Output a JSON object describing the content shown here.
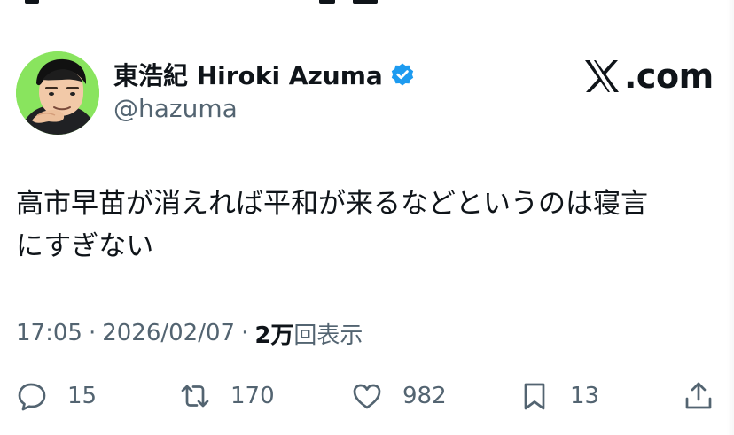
{
  "author": {
    "display_name": "東浩紀 Hiroki Azuma",
    "username": "@hazuma",
    "verified": true
  },
  "site": {
    "mark_icon": "x-logo-icon",
    "suffix": ".com"
  },
  "tweet": {
    "text": "高市早苗が消えれば平和が来るなどというのは寝言\nにすぎない"
  },
  "meta": {
    "time": "17:05",
    "date": "2026/02/07",
    "separator": "·",
    "views_count": "2万",
    "views_label": "回表示"
  },
  "actions": {
    "reply": {
      "icon": "reply-icon",
      "count": "15"
    },
    "retweet": {
      "icon": "retweet-icon",
      "count": "170"
    },
    "like": {
      "icon": "heart-icon",
      "count": "982"
    },
    "bookmark": {
      "icon": "bookmark-icon",
      "count": "13"
    },
    "share": {
      "icon": "share-icon"
    }
  },
  "colors": {
    "text_primary": "#0f1419",
    "text_secondary": "#536471",
    "verified_blue": "#1d9bf0",
    "avatar_bg": "#89e45e",
    "background": "#ffffff"
  }
}
